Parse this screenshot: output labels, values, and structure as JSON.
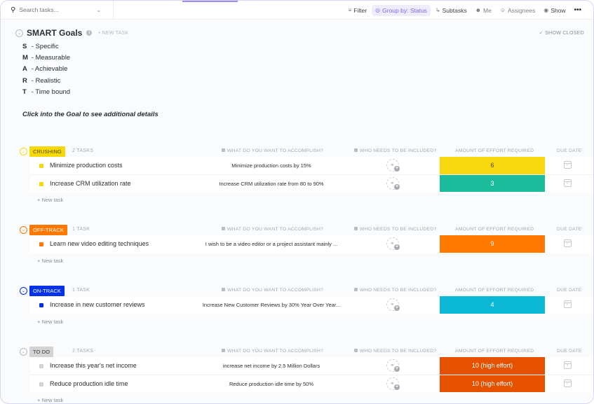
{
  "toolbar": {
    "search_placeholder": "Search tasks...",
    "filter": "Filter",
    "group_by": "Group by: Status",
    "subtasks": "Subtasks",
    "me": "Me",
    "assignees": "Assignees",
    "show": "Show",
    "more": "•••"
  },
  "list": {
    "title": "SMART Goals",
    "new_task": "+ NEW TASK",
    "show_closed": "✓ SHOW CLOSED",
    "description": [
      {
        "letter": "S",
        "text": "- Specific"
      },
      {
        "letter": "M",
        "text": "- Measurable"
      },
      {
        "letter": "A",
        "text": "- Achievable"
      },
      {
        "letter": "R",
        "text": "- Realistic"
      },
      {
        "letter": "T",
        "text": "- Time bound"
      }
    ],
    "hint": "Click into the Goal to see additional details"
  },
  "columns": {
    "what": "WHAT DO YOU WANT TO ACCOMPLISH?",
    "who": "WHO NEEDS TO BE INCLUDED?",
    "effort": "AMOUNT OF EFFORT REQUIRED",
    "due": "DUE DATE"
  },
  "new_task_label": "+ New task",
  "groups": [
    {
      "status": "CRUSHING",
      "count": "2 TASKS",
      "color": "#f5d90a",
      "text_color": "#5b4a00",
      "tasks": [
        {
          "name": "Minimize production costs",
          "what": "Minimize production costs by 15%",
          "effort": "6",
          "effort_color": "#f8d90f",
          "effort_text": "#4d4000"
        },
        {
          "name": "Increase CRM utilization rate",
          "what": "Increase CRM utilization rate from 80 to 90%",
          "effort": "3",
          "effort_color": "#1bbc9b",
          "effort_text": "#ffffff"
        }
      ]
    },
    {
      "status": "OFF-TRACK",
      "count": "1 TASK",
      "color": "#ff7800",
      "text_color": "#ffffff",
      "tasks": [
        {
          "name": "Learn new video editing techniques",
          "what": "I wish to be a video editor or a project assistant mainly ...",
          "effort": "9",
          "effort_color": "#ff7800",
          "effort_text": "#ffffff"
        }
      ]
    },
    {
      "status": "ON-TRACK",
      "count": "1 TASK",
      "color": "#0231e8",
      "text_color": "#ffffff",
      "tasks": [
        {
          "name": "Increase in new customer reviews",
          "what": "Increase New Customer Reviews by 30% Year Over Year...",
          "effort": "4",
          "effort_color": "#0ab8d5",
          "effort_text": "#ffffff"
        }
      ]
    },
    {
      "status": "TO DO",
      "count": "2 TASKS",
      "color": "#d3d3d3",
      "text_color": "#3a3a3a",
      "tasks": [
        {
          "name": "Increase this year's net income",
          "what": "increase net income by 2.5 Million Dollars",
          "effort": "10 (high effort)",
          "effort_color": "#e65100",
          "effort_text": "#ffffff"
        },
        {
          "name": "Reduce production idle time",
          "what": "Reduce production idle time by 50%",
          "effort": "10 (high effort)",
          "effort_color": "#e65100",
          "effort_text": "#ffffff"
        }
      ]
    }
  ]
}
